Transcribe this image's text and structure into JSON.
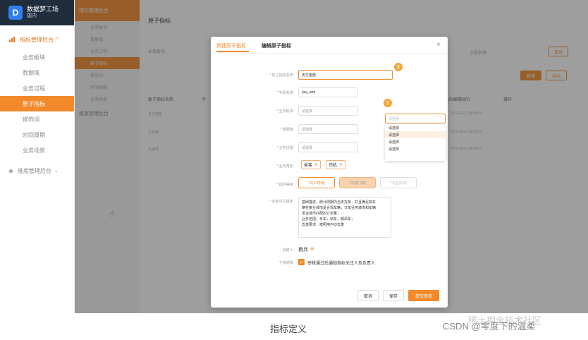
{
  "app": {
    "brand_title": "数据梦工场",
    "brand_sub": "国内",
    "logo_letter": "D"
  },
  "sidebar": {
    "group1": "指标管理后台",
    "items": [
      "业务板块",
      "数据域",
      "业务过程",
      "原子指标",
      "修饰词",
      "时间周期",
      "业务场景"
    ],
    "group2": "维度管理后台"
  },
  "sidebar2": {
    "head": "指标管理后台",
    "items": [
      "业务板块",
      "数据域",
      "业务过程",
      "原子指标",
      "修饰词",
      "时间周期",
      "业务场景"
    ],
    "group2": "维度管理后台"
  },
  "page": {
    "title": "原子指标",
    "filter_label": "业务板块",
    "filter_right_label": "字段名称",
    "search_btn": "查询",
    "new_btn": "新建",
    "export_btn": "导出",
    "columns": [
      "原子指标名称",
      "字",
      "最后编辑时间",
      "操作"
    ],
    "rows": [
      {
        "name": "支付金额",
        "time": "2019-12-12 00:00:01"
      },
      {
        "name": "订单数",
        "time": "2019-12-12 00:00:01"
      },
      {
        "name": "大活件",
        "time": "2019-12-12 00:00:01"
      }
    ]
  },
  "modal": {
    "tab_new": "新建原子指标",
    "tab_edit": "编辑原子指标",
    "close": "×",
    "fields": {
      "name_label": "原子指标名称",
      "name_value": "支付金额",
      "field_label": "字段名称",
      "field_value": "pay_amt",
      "biz_label": "业务板块",
      "biz_placeholder": "请选择",
      "domain_label": "数据域",
      "domain_placeholder": "请选择",
      "process_label": "业务过程",
      "process_placeholder": "请选择",
      "role_label": "业务角色",
      "tag1": "乘客",
      "tag2": "司机",
      "level_label": "指标等级",
      "level1": "T1(公司级)",
      "level2": "T2(部门级)",
      "level3": "T3(业务线)",
      "desc_label": "业务中文描述",
      "desc_lines": [
        "基础描述：统计周期内当天完单，并且满足其车",
        "辆在某业城市是合规车辆，订单业务城市和车辆",
        "发证城市匹配的订单量；",
        "业务范围：专车，快车，顺风车；",
        "去重要求：按照用户ID去重"
      ],
      "creator_label": "创建人",
      "creator_value": "杨兵",
      "notify_label": "下游通知",
      "notify_text": "审核通过后通知指标关注人及负责人"
    },
    "cancel": "取消",
    "save": "保存",
    "submit": "提交审核",
    "dropdown": {
      "placeholder": "请选择",
      "options": [
        "请选择",
        "请选择",
        "请选择",
        "请选择"
      ]
    },
    "badges": [
      "1",
      "2"
    ]
  },
  "caption": "指标定义",
  "watermark": "CSDN @零度下的温柔",
  "watermark2": "稀土掘金技术社区",
  "colors": {
    "accent": "#f28a2b",
    "sidebar_dark": "#1f2d3d"
  }
}
